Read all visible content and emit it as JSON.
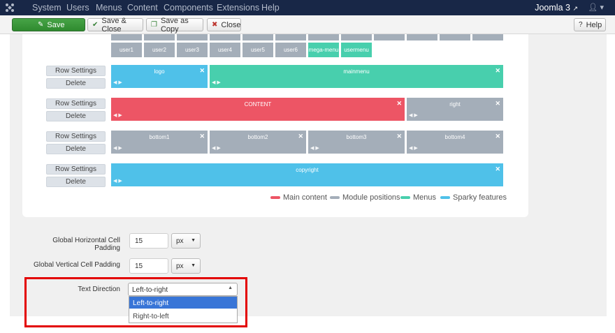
{
  "navbar": {
    "menu": [
      "System",
      "Users",
      "Menus",
      "Content",
      "Components",
      "Extensions",
      "Help"
    ],
    "brand": "Joomla 3",
    "brand_icon": "external-link-icon",
    "user_icon": "user-icon"
  },
  "toolbar": {
    "save": "Save",
    "save_close": "Save & Close",
    "save_copy": "Save as Copy",
    "close": "Close",
    "help": "Help"
  },
  "colors": {
    "main_content": "#ed5565",
    "module_positions": "#a4aeb9",
    "menus": "#48cfad",
    "sparky_features": "#4fc1e9"
  },
  "layout": {
    "chips": [
      "user1",
      "user2",
      "user3",
      "user4",
      "user5",
      "user6",
      "mega-menu",
      "usermenu"
    ],
    "row_settings": "Row Settings",
    "delete": "Delete",
    "rows": [
      {
        "cells": [
          "logo",
          "mainmenu"
        ]
      },
      {
        "cells": [
          "CONTENT",
          "right"
        ]
      },
      {
        "cells": [
          "bottom1",
          "bottom2",
          "bottom3",
          "bottom4"
        ]
      },
      {
        "cells": [
          "copyright"
        ]
      }
    ],
    "legend": [
      "Main content",
      "Module positions",
      "Menus",
      "Sparky features"
    ]
  },
  "fields": {
    "hpad_label": "Global Horizontal Cell Padding",
    "hpad_value": "15",
    "hpad_unit": "px",
    "vpad_label": "Global Vertical Cell Padding",
    "vpad_value": "15",
    "vpad_unit": "px",
    "dir_label": "Text Direction",
    "dir_value": "Left-to-right",
    "dir_options": [
      "Left-to-right",
      "Right-to-left"
    ]
  }
}
